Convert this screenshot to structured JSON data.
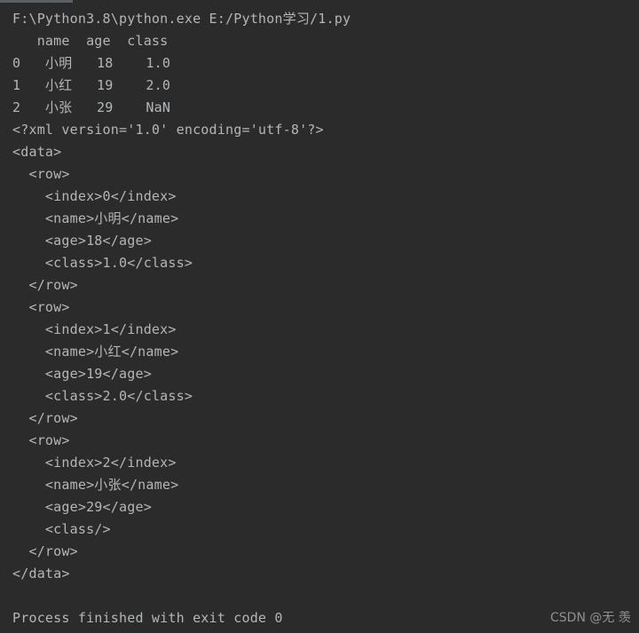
{
  "console": {
    "background_color": "#2b2b2b",
    "text_color": "#b2b7ba",
    "scrollbar_color": "#5c6063",
    "command_line": "F:\\Python3.8\\python.exe E:/Python学习/1.py",
    "dataframe": {
      "header": "   name  age  class",
      "rows": [
        "0   小明   18    1.0",
        "1   小红   19    2.0",
        "2   小张   29    NaN"
      ]
    },
    "xml_output": [
      "<?xml version='1.0' encoding='utf-8'?>",
      "<data>",
      "  <row>",
      "    <index>0</index>",
      "    <name>小明</name>",
      "    <age>18</age>",
      "    <class>1.0</class>",
      "  </row>",
      "  <row>",
      "    <index>1</index>",
      "    <name>小红</name>",
      "    <age>19</age>",
      "    <class>2.0</class>",
      "  </row>",
      "  <row>",
      "    <index>2</index>",
      "    <name>小张</name>",
      "    <age>29</age>",
      "    <class/>",
      "  </row>",
      "</data>"
    ],
    "blank_line": " ",
    "exit_message": "Process finished with exit code 0"
  },
  "watermark": {
    "text": "CSDN @无 羡"
  }
}
